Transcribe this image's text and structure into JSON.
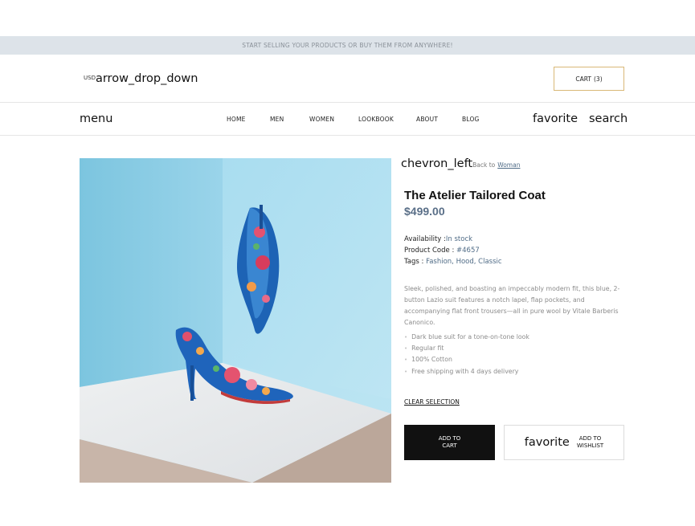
{
  "announcement": "START SELLING YOUR PRODUCTS OR BUY THEM FROM ANYWHERE!",
  "header": {
    "currency_code": "USD",
    "currency_dropdown_icon": "arrow_drop_down",
    "cart_label": "CART",
    "cart_count": "(3)"
  },
  "nav": {
    "menu_icon": "menu",
    "links": [
      "HOME",
      "MEN",
      "WOMEN",
      "LOOKBOOK",
      "ABOUT",
      "BLOG"
    ],
    "favorite_icon": "favorite",
    "search_icon": "search"
  },
  "product": {
    "back_icon": "chevron_left",
    "back_label": "Back to",
    "back_link": "Woman",
    "title": "The Atelier Tailored Coat",
    "price": "$499.00",
    "availability_label": "Availability :",
    "availability_value": "In stock",
    "code_label": "Product Code :",
    "code_value": "#4657",
    "tags_label": "Tags :",
    "tags_value": "Fashion, Hood, Classic",
    "description": "Sleek, polished, and boasting an impeccably modern fit, this blue, 2-button Lazio suit features a notch lapel, flap pockets, and accompanying flat front trousers—all in pure wool by Vitale Barberis Canonico.",
    "features": [
      "Dark blue suit for a tone-on-tone look",
      "Regular fit",
      "100% Cotton",
      "Free shipping with 4 days delivery"
    ],
    "clear_selection": "CLEAR SELECTION",
    "add_to_cart": "ADD TO\nCART",
    "wishlist_icon": "favorite",
    "add_to_wishlist": "ADD TO\nWISHLIST"
  },
  "colors": {
    "announce_bg": "#dde3e9",
    "price": "#5a6f88",
    "link": "#4f6b86",
    "cart_border": "#d9b877",
    "button_dark": "#111111"
  }
}
